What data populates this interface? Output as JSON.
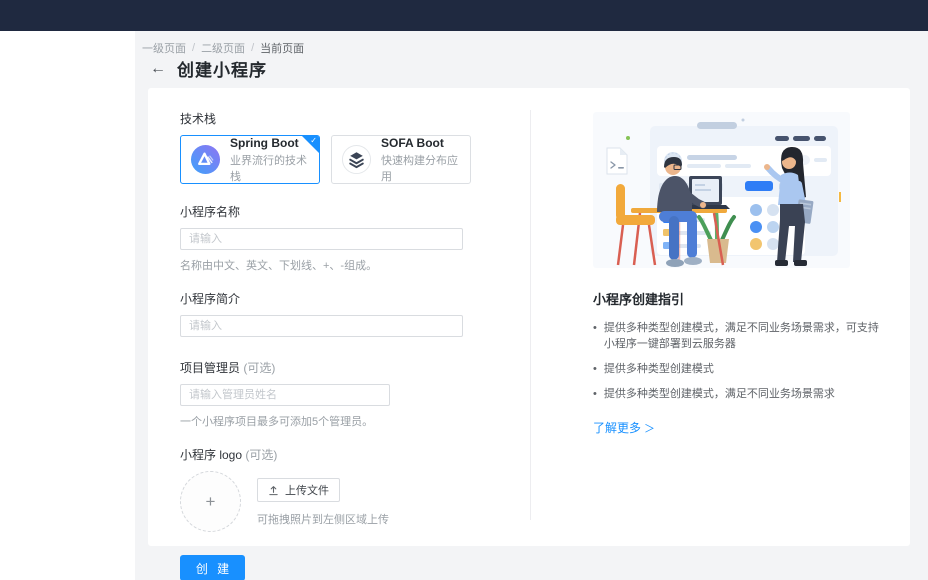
{
  "topbar": {},
  "breadcrumb": {
    "separator": "/",
    "items": [
      "一级页面",
      "二级页面",
      "当前页面"
    ]
  },
  "page": {
    "back_glyph": "←",
    "title": "创建小程序"
  },
  "form": {
    "tech_stack": {
      "label": "技术栈",
      "check_glyph": "✓",
      "options": [
        {
          "name": "Spring Boot",
          "desc": "业界流行的技术栈",
          "selected": true
        },
        {
          "name": "SOFA Boot",
          "desc": "快速构建分布应用",
          "selected": false
        }
      ]
    },
    "name_field": {
      "label": "小程序名称",
      "placeholder": "请输入",
      "help": "名称由中文、英文、下划线、+、-组成。"
    },
    "intro_field": {
      "label": "小程序简介",
      "placeholder": "请输入"
    },
    "admin_field": {
      "label": "项目管理员",
      "optional": "(可选)",
      "placeholder": "请输入管理员姓名",
      "help": "一个小程序项目最多可添加5个管理员。"
    },
    "logo_field": {
      "label": "小程序 logo",
      "optional": "(可选)",
      "plus_glyph": "+",
      "upload_button": "上传文件",
      "drag_hint": "可拖拽照片到左侧区域上传"
    },
    "submit_label": "创 建"
  },
  "guide": {
    "title": "小程序创建指引",
    "bullets": [
      "提供多种类型创建模式，满足不同业务场景需求，可支持小程序一键部署到云服务器",
      "提供多种类型创建模式",
      "提供多种类型创建模式，满足不同业务场景需求"
    ],
    "more_label": "了解更多",
    "more_arrow": "＞"
  },
  "colors": {
    "topbar_bg": "#1f2940",
    "page_bg": "#f3f4f6",
    "primary": "#1890ff",
    "text_dark": "#24292e",
    "text_muted": "#9aa0a6",
    "border": "#d9dce0"
  }
}
